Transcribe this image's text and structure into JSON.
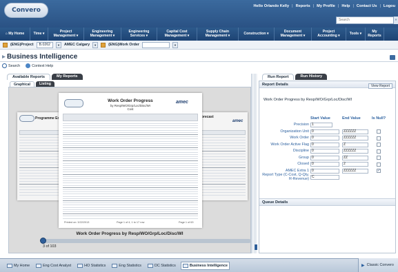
{
  "header": {
    "logo": "Convero",
    "links": [
      "Hello Orlando Kelly",
      "Reports",
      "My Profile",
      "Help",
      "Contact Us",
      "Logou"
    ],
    "search_placeholder": "Search",
    "search_go": "»"
  },
  "nav": {
    "items": [
      {
        "label": "⌂ My Home",
        "w": 44
      },
      {
        "label": "Time ▾",
        "w": 26
      },
      {
        "label": "Project\nManagement ▾",
        "w": 52
      },
      {
        "label": "Engineering\nManagement ▾",
        "w": 54
      },
      {
        "label": "Engineering\nServices ▾",
        "w": 52
      },
      {
        "label": "Capital Cost\nManagement ▾",
        "w": 58
      },
      {
        "label": "Supply Chain\nManagement ▾",
        "w": 60
      },
      {
        "label": "Construction ▾",
        "w": 52
      },
      {
        "label": "Document\nManagement ▾",
        "w": 54
      },
      {
        "label": "Project\nAccounting ▾",
        "w": 50
      },
      {
        "label": "Tools ▾",
        "w": 28
      },
      {
        "label": "My\nReports",
        "w": 27
      }
    ]
  },
  "context": {
    "project_label": "(ENG)Project",
    "project_value": "B.0262",
    "company": "AMEC Calgary",
    "workorder_label": "(ENG)Work Order"
  },
  "page_title": "Business Intelligence",
  "toolbar": {
    "search": "Search",
    "context_help": "Context Help"
  },
  "left_tabs": {
    "available": "Available Reports",
    "my": "My Reports"
  },
  "sub_tabs": {
    "graphical": "Graphical",
    "listing": "Listing"
  },
  "preview": {
    "main_title": "Work Order Progress",
    "main_subtitle": "by Resp/WO/Grp/Loc/Disc/WI",
    "main_subtitle2": "Cost",
    "back_left_title": "Programme Eng Progr",
    "back_right_title": "PF Forecast",
    "back_right_sub": "ions",
    "brand": "amec",
    "footer_left": "Printed on: 3/22/2013",
    "footer_mid": "Page 1 of 4, 1 to 17 row",
    "footer_right": "Page 1 of 63",
    "caption": "Work Order Progress by Resp/WO/Grp/Loc/Disc/WI",
    "page_count": "3 of 103"
  },
  "right_tabs": {
    "run_report": "Run Report",
    "run_history": "Run History"
  },
  "report_details": {
    "header": "Report Details",
    "view_report": "View Report",
    "report_name": "Work Order Progress by Resp/WO/Grp/Loc/Disc/WI",
    "col_start": "Start Value",
    "col_end": "End Value",
    "col_null": "Is Null?",
    "params": [
      {
        "label": "Precision",
        "start": "1",
        "end": "",
        "null": false,
        "single": true
      },
      {
        "label": "Organization Unit",
        "start": "0",
        "end": "ZZZZZZ",
        "null": false
      },
      {
        "label": "Work Order",
        "start": "0",
        "end": "ZZZZZZ",
        "null": false
      },
      {
        "label": "Work Order Active Flag",
        "start": "0",
        "end": "Z",
        "null": false
      },
      {
        "label": "Discipline",
        "start": "0",
        "end": "ZZZZZZ",
        "null": false
      },
      {
        "label": "Group",
        "start": "0",
        "end": "ZZ",
        "null": false
      },
      {
        "label": "Closed",
        "start": "0",
        "end": "2",
        "null": false
      },
      {
        "label": "AMEC Extra 1",
        "start": "0",
        "end": "ZZZZZZ",
        "null": true
      },
      {
        "label": "Report Type (C-Cost, Q-Qty, R-Revenue)",
        "start": "C",
        "end": "",
        "null": false,
        "single": true
      }
    ],
    "queue_header": "Queue Details"
  },
  "taskbar": {
    "items": [
      "My Home",
      "Eng Cost Analyst",
      "HO Statistics",
      "Eng Statistics",
      "DC Statistics",
      "Business Intelligence"
    ],
    "classic": "Classic Convero"
  },
  "colors": {
    "header": "#2a5284",
    "nav": "#1d4373",
    "accent": "#2a5f9e",
    "tab_dark": "#3a3f47"
  }
}
